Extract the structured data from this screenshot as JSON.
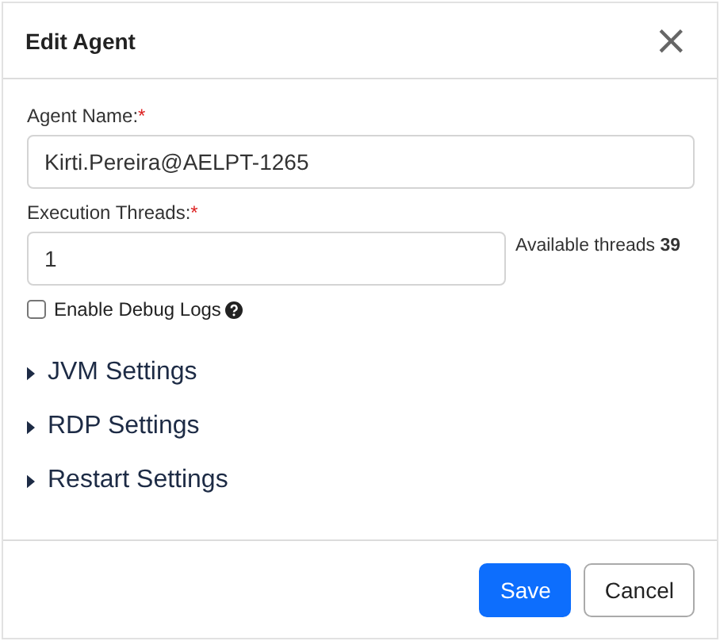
{
  "dialog": {
    "title": "Edit Agent",
    "close": "×"
  },
  "fields": [
    {
      "label": "Agent Name:",
      "required_mark": "*",
      "value": "Kirti.Pereira@AELPT-1265"
    },
    {
      "label": "Execution Threads:",
      "required_mark": "*",
      "value": "1",
      "note": "Available threads **39**"
    }
  ],
  "debug": {
    "label": "Enable Debug Logs",
    "checked": false
  },
  "sections": [
    {
      "label": "JVM Settings",
      "expanded": false
    },
    {
      "label": "RDP Settings",
      "expanded": false
    },
    {
      "label": "Restart Settings",
      "expanded": false
    }
  ],
  "buttons": [
    {
      "label": "Save",
      "kind": "primary"
    },
    {
      "label": "Cancel",
      "kind": "secondary"
    }
  ]
}
